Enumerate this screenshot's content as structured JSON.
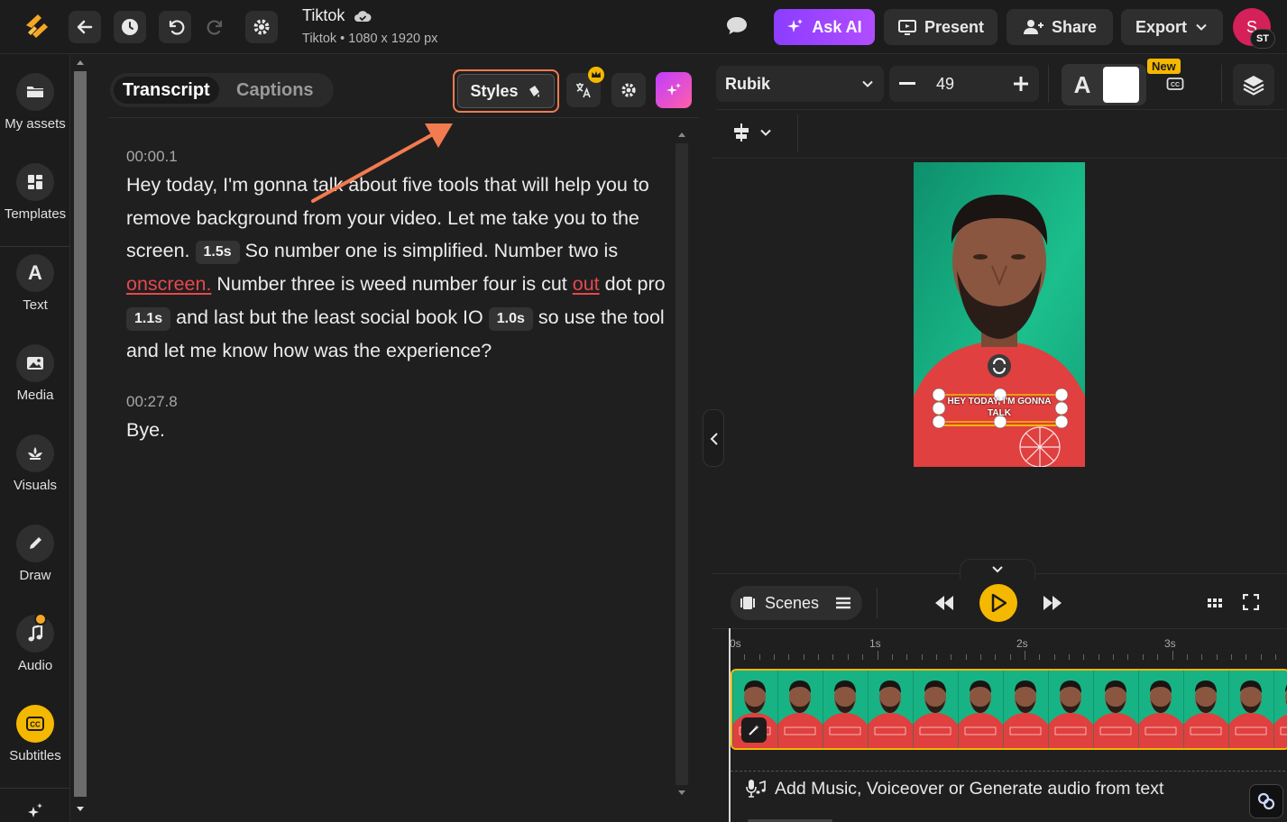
{
  "topbar": {
    "project_title": "Tiktok",
    "project_subtitle": "Tiktok • 1080 x 1920 px",
    "ask_ai_label": "Ask AI",
    "present_label": "Present",
    "share_label": "Share",
    "export_label": "Export",
    "avatar_letter": "S",
    "avatar_badge": "ST",
    "accent_color": "#8b3dff",
    "brand_color": "#f5a623"
  },
  "leftnav": {
    "items": [
      {
        "label": "My assets",
        "icon": "folder-icon"
      },
      {
        "label": "Templates",
        "icon": "templates-icon"
      },
      {
        "label": "Text",
        "icon": "text-icon"
      },
      {
        "label": "Media",
        "icon": "image-icon"
      },
      {
        "label": "Visuals",
        "icon": "visuals-icon"
      },
      {
        "label": "Draw",
        "icon": "pen-icon"
      },
      {
        "label": "Audio",
        "icon": "music-icon"
      },
      {
        "label": "Subtitles",
        "icon": "cc-icon"
      }
    ],
    "active_item": "Subtitles"
  },
  "panel": {
    "tabs": [
      "Transcript",
      "Captions"
    ],
    "active_tab": "Transcript",
    "styles_label": "Styles",
    "blocks": [
      {
        "timestamp": "00:00.1",
        "seg1": "Hey today, I'm gonna talk about five tools that will help you to remove background from your video. Let me take you to the screen.",
        "pause1": "1.5s",
        "seg2": "So number one is simplified. Number two is",
        "err1": "onscreen.",
        "seg3": "Number three is weed number four is cut",
        "err2": "out",
        "seg4": "dot pro",
        "pause2": "1.1s",
        "seg5": "and last but the least social book IO",
        "pause3": "1.0s",
        "seg6": "so use the tool and let me know how was the experience?"
      },
      {
        "timestamp": "00:27.8",
        "text": "Bye."
      }
    ]
  },
  "toolbar": {
    "font_name": "Rubik",
    "font_size": "49",
    "text_style_letter": "A",
    "new_badge": "New",
    "text_color": "#ffffff"
  },
  "preview": {
    "caption_line1": "HEY TODAY, I'M GONNA",
    "caption_line2": "TALK"
  },
  "timeline": {
    "scenes_label": "Scenes",
    "ruler_labels": [
      "0s",
      "1s",
      "2s",
      "3s"
    ],
    "audio_prompt": "Add Music, Voiceover or Generate audio from text",
    "play_color": "#f5b800"
  }
}
